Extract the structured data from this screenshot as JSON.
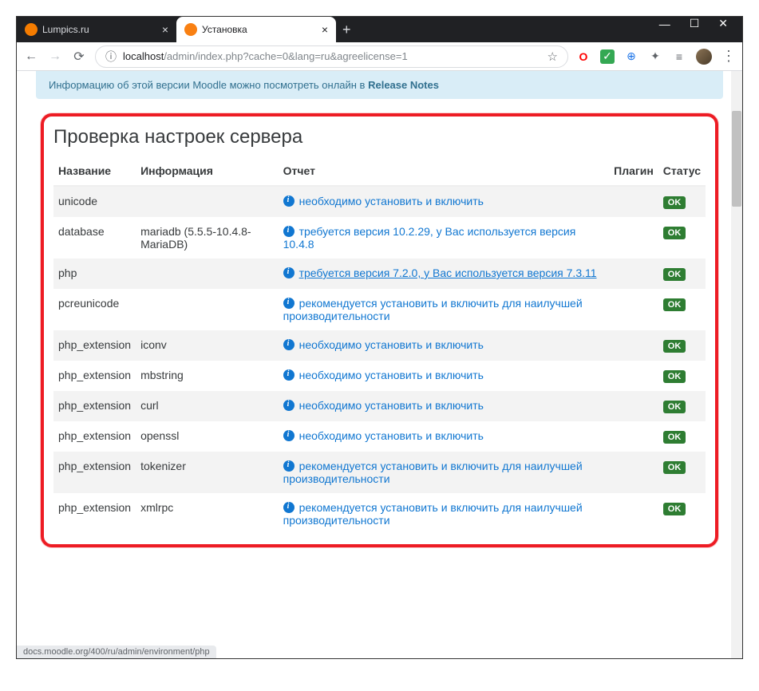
{
  "tabs": [
    {
      "title": "Lumpics.ru",
      "favicon_color": "#f57c00"
    },
    {
      "title": "Установка",
      "favicon_color": "#f98012"
    }
  ],
  "window_controls": {
    "min": "—",
    "max": "☐",
    "close": "✕"
  },
  "nav": {
    "back": "←",
    "forward": "→",
    "reload": "⟳"
  },
  "url": {
    "host": "localhost",
    "path": "/admin/index.php?cache=0&lang=ru&agreelicense=1"
  },
  "notice_text": "Информацию об этой версии Moodle можно посмотреть онлайн в",
  "notice_link": "Release Notes",
  "section_title": "Проверка настроек сервера",
  "headers": {
    "name": "Название",
    "info": "Информация",
    "report": "Отчет",
    "plugin": "Плагин",
    "status": "Статус"
  },
  "ok_label": "OK",
  "rows": [
    {
      "name": "unicode",
      "info": "",
      "report": "необходимо установить и включить",
      "underlined": false
    },
    {
      "name": "database",
      "info": "mariadb (5.5.5-10.4.8-MariaDB)",
      "report": "требуется версия 10.2.29, у Вас используется версия 10.4.8",
      "underlined": false
    },
    {
      "name": "php",
      "info": "",
      "report": "требуется версия 7.2.0, у Вас используется версия 7.3.11",
      "underlined": true
    },
    {
      "name": "pcreunicode",
      "info": "",
      "report": "рекомендуется установить и включить для наилучшей производительности",
      "underlined": false
    },
    {
      "name": "php_extension",
      "info": "iconv",
      "report": "необходимо установить и включить",
      "underlined": false
    },
    {
      "name": "php_extension",
      "info": "mbstring",
      "report": "необходимо установить и включить",
      "underlined": false
    },
    {
      "name": "php_extension",
      "info": "curl",
      "report": "необходимо установить и включить",
      "underlined": false
    },
    {
      "name": "php_extension",
      "info": "openssl",
      "report": "необходимо установить и включить",
      "underlined": false
    },
    {
      "name": "php_extension",
      "info": "tokenizer",
      "report": "рекомендуется установить и включить для наилучшей производительности",
      "underlined": false
    },
    {
      "name": "php_extension",
      "info": "xmlrpc",
      "report": "рекомендуется установить и включить для наилучшей производительности",
      "underlined": false
    }
  ],
  "statusbar_hint": "docs.moodle.org/400/ru/admin/environment/php"
}
